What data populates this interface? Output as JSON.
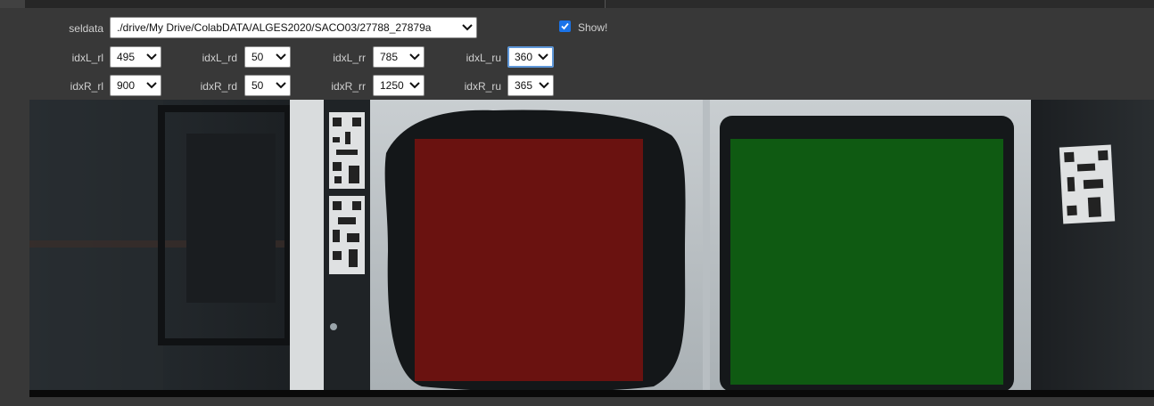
{
  "seldata": {
    "label": "seldata",
    "value": "./drive/My Drive/ColabDATA/ALGES2020/SACO03/27788_27879a"
  },
  "show": {
    "label": "Show!",
    "checked": true
  },
  "left_row": [
    {
      "label": "idxL_rl",
      "value": "495"
    },
    {
      "label": "idxL_rd",
      "value": "50"
    },
    {
      "label": "idxL_rr",
      "value": "785"
    },
    {
      "label": "idxL_ru",
      "value": "360"
    }
  ],
  "right_row": [
    {
      "label": "idxR_rl",
      "value": "900"
    },
    {
      "label": "idxR_rd",
      "value": "50"
    },
    {
      "label": "idxR_rr",
      "value": "1250"
    },
    {
      "label": "idxR_ru",
      "value": "365"
    }
  ],
  "image": {
    "left_roi_color": "#6a1210",
    "right_roi_color": "#0f5a12"
  }
}
